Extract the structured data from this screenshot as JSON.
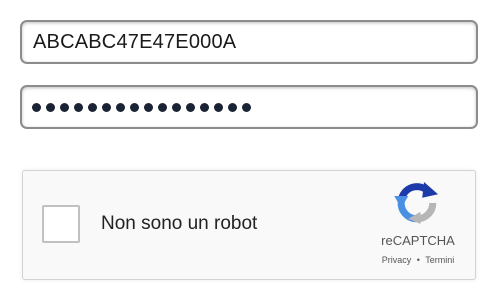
{
  "login": {
    "username_value": "ABCABC47E47E000A",
    "password_mask_count": 16
  },
  "captcha": {
    "label": "Non sono un robot",
    "brand": "reCAPTCHA",
    "privacy_link": "Privacy",
    "separator": "•",
    "terms_link": "Termini",
    "logo_icon": "recaptcha-logo-icon",
    "colors": {
      "blue": "#1c3aa9",
      "light_blue": "#4a90e2",
      "gray": "#b6b6b6"
    }
  }
}
